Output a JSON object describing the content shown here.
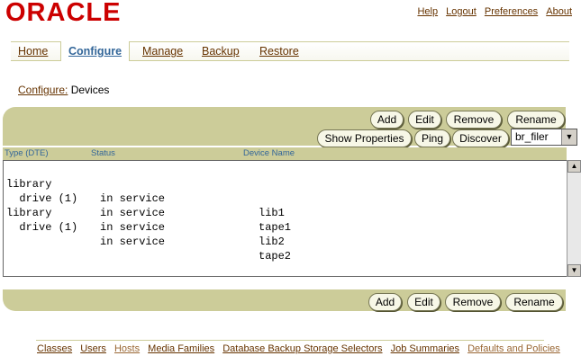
{
  "header": {
    "logo_text": "ORACLE",
    "global_links": [
      "Help",
      "Logout",
      "Preferences",
      "About"
    ]
  },
  "tabs": [
    {
      "label": "Home",
      "active": false
    },
    {
      "label": "Configure",
      "active": true
    },
    {
      "label": "Manage",
      "active": false
    },
    {
      "label": "Backup",
      "active": false
    },
    {
      "label": "Restore",
      "active": false
    }
  ],
  "breadcrumb": {
    "link": "Configure:",
    "current": "Devices"
  },
  "toolbar_top": {
    "row1": [
      "Add",
      "Edit",
      "Remove",
      "Rename"
    ],
    "row2": [
      "Show Properties",
      "Ping",
      "Discover"
    ],
    "host_select": "br_filer"
  },
  "columns": [
    "Type (DTE)",
    "Status",
    "Device Name"
  ],
  "devices": [
    {
      "type": "library",
      "status": "in service",
      "name": "lib1"
    },
    {
      "type": "  drive (1)",
      "status": "in service",
      "name": "tape1"
    },
    {
      "type": "library",
      "status": "in service",
      "name": "lib2"
    },
    {
      "type": "  drive (1)",
      "status": "in service",
      "name": "tape2"
    }
  ],
  "toolbar_bottom": [
    "Add",
    "Edit",
    "Remove",
    "Rename"
  ],
  "footer_links": [
    "Classes",
    "Users",
    "Hosts",
    "Media Families",
    "Database Backup Storage Selectors",
    "Job Summaries",
    "Defaults and Policies"
  ],
  "colors": {
    "bar": "#cccc99",
    "link": "#663300",
    "active_tab": "#336699",
    "logo": "#cc0000"
  },
  "icons": [
    "scroll-up-icon",
    "scroll-down-icon",
    "dropdown-arrow-icon"
  ]
}
